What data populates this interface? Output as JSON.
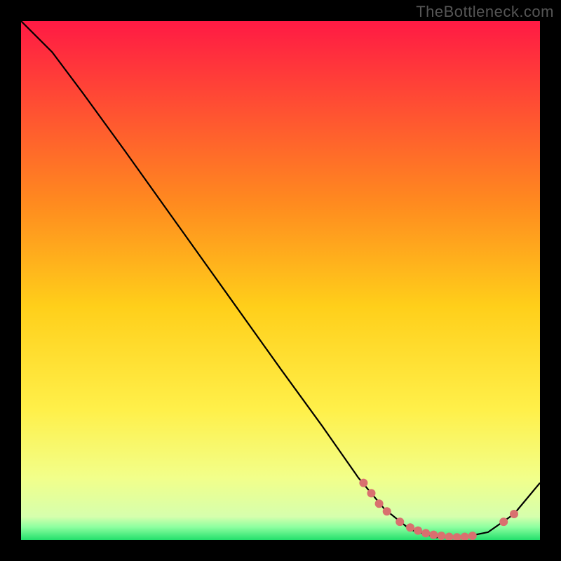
{
  "watermark": "TheBottleneck.com",
  "colors": {
    "background": "#000000",
    "curve_stroke": "#000000",
    "marker_fill": "#d9706f",
    "gradient_top": "#ff1a44",
    "gradient_mid1": "#ff9a1a",
    "gradient_mid2": "#ffe41a",
    "gradient_low": "#f8ff7a",
    "gradient_bottom": "#23e06c"
  },
  "chart_data": {
    "type": "line",
    "title": "",
    "xlabel": "",
    "ylabel": "",
    "xlim": [
      0,
      100
    ],
    "ylim": [
      0,
      100
    ],
    "curve_points": [
      {
        "x": 0,
        "y": 100
      },
      {
        "x": 6,
        "y": 94
      },
      {
        "x": 12,
        "y": 86
      },
      {
        "x": 20,
        "y": 75
      },
      {
        "x": 30,
        "y": 61
      },
      {
        "x": 40,
        "y": 47
      },
      {
        "x": 50,
        "y": 33
      },
      {
        "x": 58,
        "y": 22
      },
      {
        "x": 65,
        "y": 12
      },
      {
        "x": 70,
        "y": 6
      },
      {
        "x": 75,
        "y": 2
      },
      {
        "x": 80,
        "y": 0.5
      },
      {
        "x": 85,
        "y": 0.5
      },
      {
        "x": 90,
        "y": 1.5
      },
      {
        "x": 95,
        "y": 5
      },
      {
        "x": 100,
        "y": 11
      }
    ],
    "markers": [
      {
        "x": 66,
        "y": 11
      },
      {
        "x": 67.5,
        "y": 9
      },
      {
        "x": 69,
        "y": 7
      },
      {
        "x": 70.5,
        "y": 5.5
      },
      {
        "x": 73,
        "y": 3.5
      },
      {
        "x": 75,
        "y": 2.4
      },
      {
        "x": 76.5,
        "y": 1.8
      },
      {
        "x": 78,
        "y": 1.3
      },
      {
        "x": 79.5,
        "y": 1.0
      },
      {
        "x": 81,
        "y": 0.8
      },
      {
        "x": 82.5,
        "y": 0.6
      },
      {
        "x": 84,
        "y": 0.5
      },
      {
        "x": 85.5,
        "y": 0.6
      },
      {
        "x": 87,
        "y": 0.8
      },
      {
        "x": 93,
        "y": 3.5
      },
      {
        "x": 95,
        "y": 5.0
      }
    ],
    "gradient_stops": [
      {
        "offset": 0.0,
        "color": "#ff1a44"
      },
      {
        "offset": 0.35,
        "color": "#ff8a1f"
      },
      {
        "offset": 0.55,
        "color": "#ffcf1a"
      },
      {
        "offset": 0.75,
        "color": "#fff04a"
      },
      {
        "offset": 0.88,
        "color": "#f2ff8a"
      },
      {
        "offset": 0.955,
        "color": "#d6ffad"
      },
      {
        "offset": 0.975,
        "color": "#8effa0"
      },
      {
        "offset": 1.0,
        "color": "#23e06c"
      }
    ]
  }
}
